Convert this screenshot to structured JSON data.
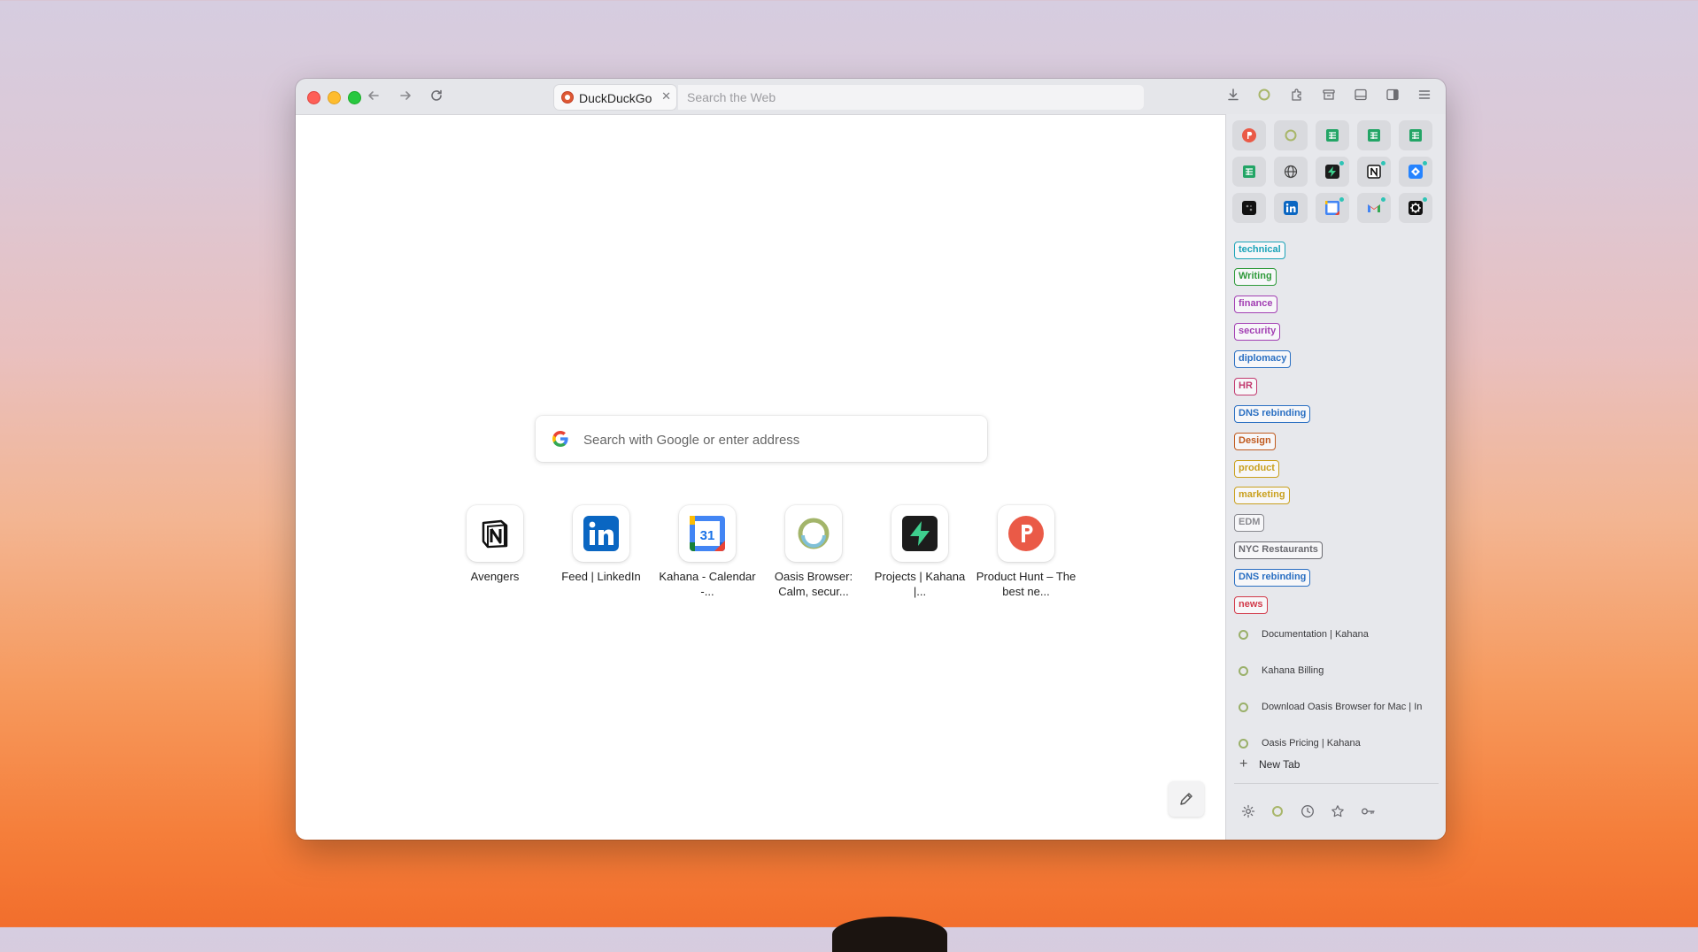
{
  "tab": {
    "title": "DuckDuckGo",
    "close": "✕"
  },
  "urlbar": {
    "placeholder": "Search the Web"
  },
  "search": {
    "placeholder": "Search with Google or enter address"
  },
  "shortcuts": [
    {
      "label": "Avengers"
    },
    {
      "label": "Feed | LinkedIn"
    },
    {
      "label": "Kahana - Calendar -..."
    },
    {
      "label": "Oasis Browser: Calm, secur..."
    },
    {
      "label": "Projects | Kahana |..."
    },
    {
      "label": "Product Hunt – The best ne..."
    }
  ],
  "calendar_day": "31",
  "folders": [
    {
      "label": "technical",
      "color": "#1aa3b8"
    },
    {
      "label": "Writing",
      "color": "#2e9a3a"
    },
    {
      "label": "finance",
      "color": "#a23fb3"
    },
    {
      "label": "security",
      "color": "#a23fb3"
    },
    {
      "label": "diplomacy",
      "color": "#2a6fc2"
    },
    {
      "label": "HR",
      "color": "#c23a6f"
    },
    {
      "label": "DNS rebinding",
      "color": "#2a6fc2"
    },
    {
      "label": "Design",
      "color": "#c05a1e"
    },
    {
      "label": "product",
      "color": "#c9a01e"
    },
    {
      "label": "marketing",
      "color": "#c9a01e"
    },
    {
      "label": "EDM",
      "color": "#8a8a90"
    },
    {
      "label": "NYC Restaurants",
      "color": "#6a6a70"
    },
    {
      "label": "DNS rebinding",
      "color": "#2a6fc2"
    },
    {
      "label": "news",
      "color": "#d23a4a"
    }
  ],
  "sidebar_tabs": [
    {
      "title": "Documentation | Kahana"
    },
    {
      "title": "Kahana Billing"
    },
    {
      "title": "Download Oasis Browser for Mac | In"
    },
    {
      "title": "Oasis Pricing | Kahana"
    }
  ],
  "new_tab_label": "New Tab",
  "pinned_icons": [
    "product-hunt-icon",
    "oasis-icon",
    "sheets-icon",
    "sheets-icon",
    "sheets-icon",
    "sheets-icon",
    "globe-icon",
    "bolt-icon",
    "notion-icon",
    "jira-icon",
    "dark-app-icon",
    "linkedin-icon",
    "calendar-icon",
    "gmail-icon",
    "settings-app-icon"
  ],
  "colors": {
    "accent_red": "#fe5f57",
    "accent_yellow": "#febc2e",
    "accent_green": "#28c840"
  }
}
